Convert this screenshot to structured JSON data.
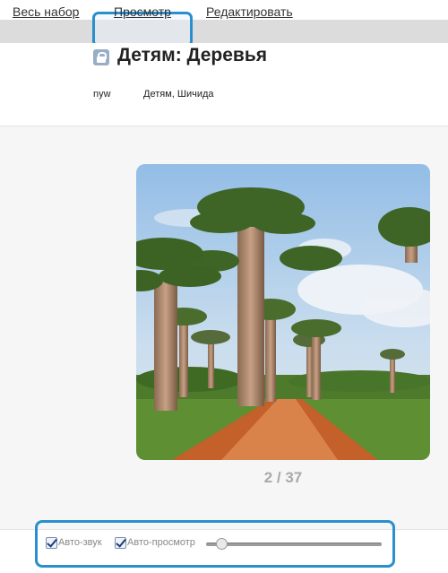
{
  "tabs": [
    {
      "label": "Весь набор"
    },
    {
      "label": "Просмотр"
    },
    {
      "label": "Редактировать"
    }
  ],
  "header": {
    "title": "Детям: Деревья",
    "author": "nyw",
    "tags": "Детям, Шичида"
  },
  "viewer": {
    "counter": "2 / 37",
    "image_subject": "baobab trees along a dirt road"
  },
  "controls": {
    "auto_sound_label": "Авто-звук",
    "auto_sound_checked": true,
    "auto_view_label": "Авто-просмотр",
    "auto_view_checked": true,
    "speed_slider_fraction": 0.1
  },
  "colors": {
    "highlight": "#2a8fce",
    "tabbar": "#dcdcdc",
    "counter": "#a9a9a9"
  }
}
